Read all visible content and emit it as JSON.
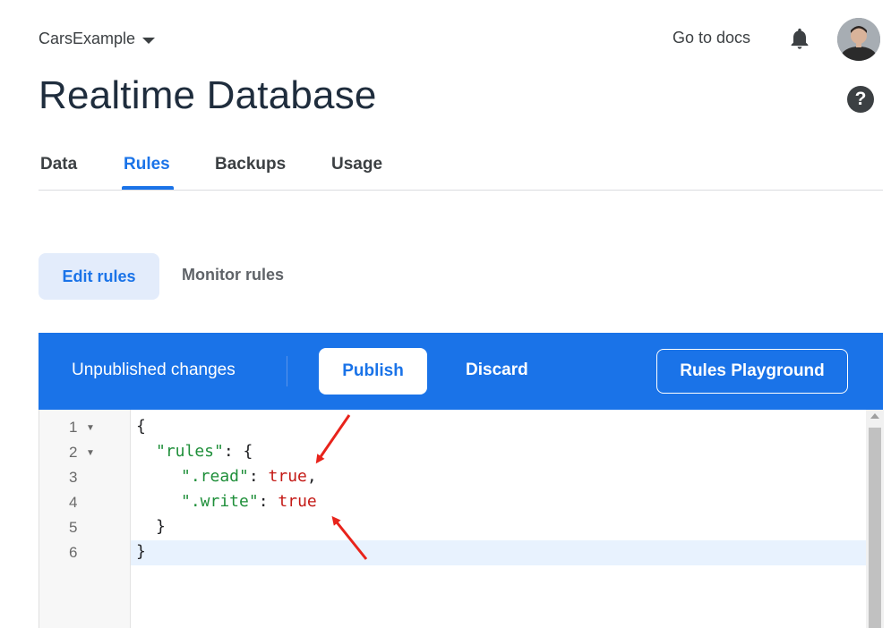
{
  "header": {
    "project_name": "CarsExample",
    "docs_link": "Go to docs",
    "page_title": "Realtime Database",
    "help_icon": "?"
  },
  "tabs": [
    {
      "label": "Data"
    },
    {
      "label": "Rules",
      "active": true
    },
    {
      "label": "Backups"
    },
    {
      "label": "Usage"
    }
  ],
  "subtabs": {
    "edit": "Edit rules",
    "monitor": "Monitor rules"
  },
  "toolbar": {
    "status": "Unpublished changes",
    "publish": "Publish",
    "discard": "Discard",
    "playground": "Rules Playground"
  },
  "editor": {
    "line_numbers": [
      "1",
      "2",
      "3",
      "4",
      "5",
      "6"
    ],
    "lines": [
      {
        "indent": "",
        "open": "{"
      },
      {
        "key": "\"rules\"",
        "sep": ": ",
        "brace": "{"
      },
      {
        "key": "\".read\"",
        "sep": ": ",
        "value": "true",
        "trail": ","
      },
      {
        "key": "\".write\"",
        "sep": ": ",
        "value": "true"
      },
      {
        "close": "}"
      },
      {
        "close": "}"
      }
    ]
  },
  "colors": {
    "accent": "#1a73e8",
    "key_string": "#1f8f3a",
    "boolean": "#c41a16",
    "annotation_arrow": "#e8231b"
  },
  "icons": [
    "chevron-down-icon",
    "bell-icon",
    "avatar",
    "help-icon",
    "fold-arrow-icon",
    "annotation-arrow"
  ]
}
